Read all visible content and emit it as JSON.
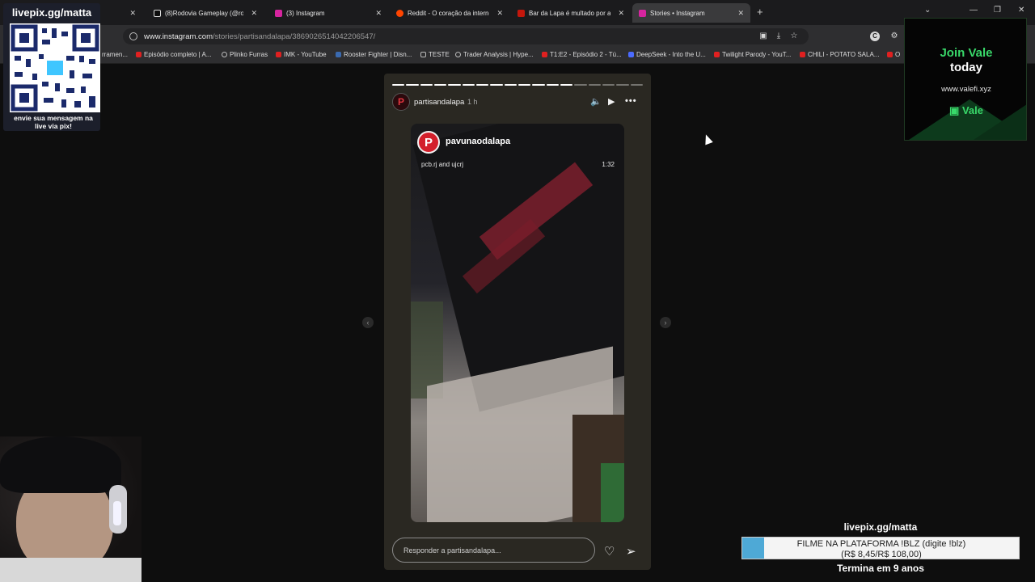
{
  "browser": {
    "tabs": [
      {
        "title": "",
        "color": "#1f1f1f"
      },
      {
        "title": "(8)Rodovia Gameplay (@rodovi",
        "color": "#0d0d0d"
      },
      {
        "title": "(3) Instagram",
        "color": "#d6249f"
      },
      {
        "title": "Reddit - O coração da internet",
        "color": "#ff4500"
      },
      {
        "title": "Bar da Lapa é multado por aviso",
        "color": "#c4170c"
      },
      {
        "title": "Stories • Instagram",
        "color": "#d6249f",
        "active": true
      }
    ],
    "url_host": "www.instagram.com",
    "url_path": "/stories/partisandalapa/3869026514042206547/",
    "bookmarks": [
      {
        "label": "rramen...",
        "color": "#777777"
      },
      {
        "label": "Episódio completo | A...",
        "color": "#e02020"
      },
      {
        "label": "Plinko Furras",
        "color": "#bbbbbb"
      },
      {
        "label": "IMK - YouTube",
        "color": "#e02020"
      },
      {
        "label": "Rooster Fighter | Disn...",
        "color": "#3a6ab0"
      },
      {
        "label": "TESTE",
        "color": "#bbbbbb"
      },
      {
        "label": "Trader Analysis | Hype...",
        "color": "#bbbbbb"
      },
      {
        "label": "T1:E2 - Episódio 2 - Tú...",
        "color": "#e02020"
      },
      {
        "label": "DeepSeek - Into the U...",
        "color": "#4b6bff"
      },
      {
        "label": "Twilight Parody - YouT...",
        "color": "#e02020"
      },
      {
        "label": "CHILI - POTATO SALA...",
        "color": "#e02020"
      },
      {
        "label": "O",
        "color": "#e02020"
      }
    ]
  },
  "overlay_qr": {
    "title": "livepix.gg/matta",
    "caption_line1": "envie sua mensagem na",
    "caption_line2": "live via pix!"
  },
  "overlay_vale": {
    "join": "Join Vale",
    "today": "today",
    "url": "www.valefi.xyz",
    "brand": "Vale"
  },
  "story": {
    "username": "partisandalapa",
    "time": "1 h",
    "segments_total": 18,
    "segments_done": 13,
    "post_username": "pavunaodalapa",
    "post_credit": "pcb.rj and ujcrj",
    "post_duration": "1:32",
    "reply_placeholder": "Responder a partisandalapa..."
  },
  "ticker": {
    "url": "livepix.gg/matta",
    "line1": "FILME NA PLATAFORMA !BLZ (digite !blz)",
    "line2": "(R$ 8,45/R$ 108,00)",
    "progress_fraction": 0.078,
    "ends": "Termina em 9 anos"
  }
}
